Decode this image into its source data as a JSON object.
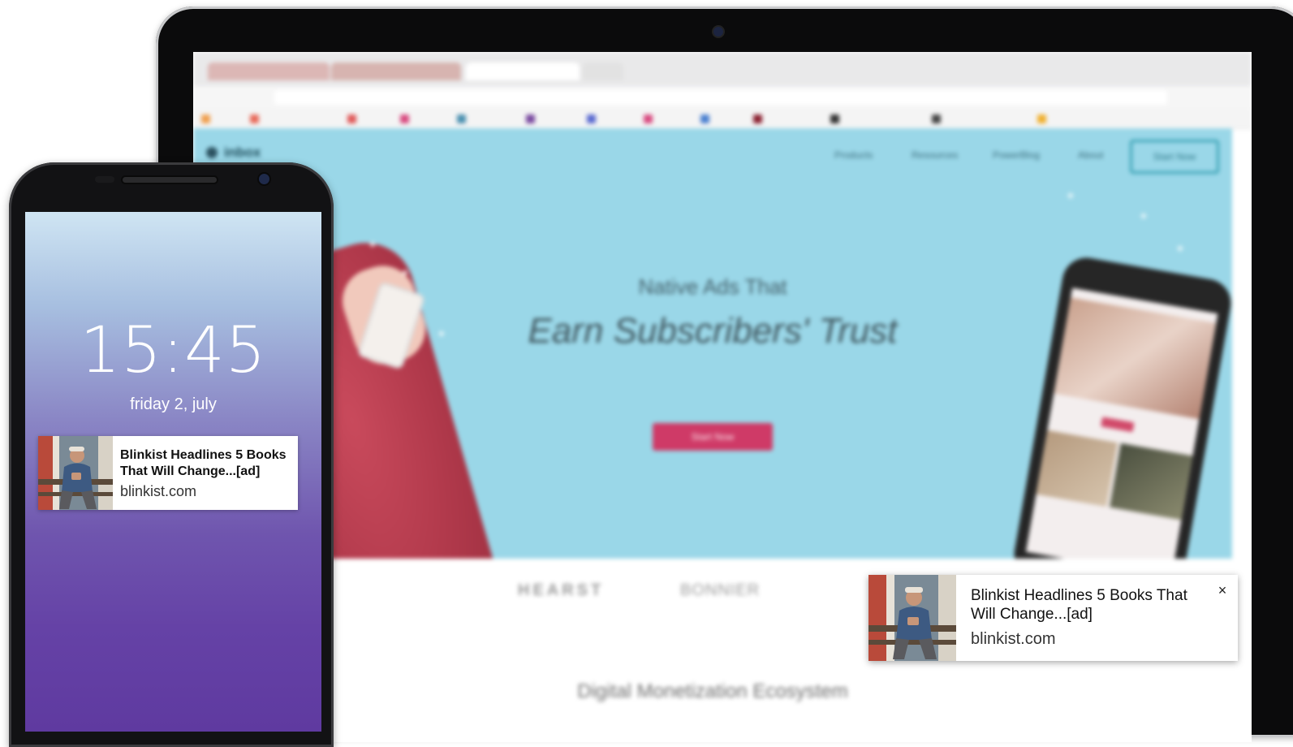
{
  "phone": {
    "lock_time": "15:45",
    "lock_date": "friday 2, july",
    "notification": {
      "title": "Blinkist Headlines 5 Books That Will Change...[ad]",
      "domain": "blinkist.com",
      "thumb_icon": "man-reading-phone-photo"
    }
  },
  "desktop_notification": {
    "title": "Blinkist Headlines 5 Books That Will Change...[ad]",
    "domain": "blinkist.com",
    "close_label": "×",
    "thumb_icon": "man-reading-phone-photo"
  },
  "website": {
    "nav": [
      "Products",
      "Resources",
      "PowerBlog",
      "About"
    ],
    "nav_cta": "Start Now",
    "hero_line1": "Native Ads That",
    "hero_line2": "Earn Subscribers' Trust",
    "hero_button": "Start Now",
    "section_title": "Digital Monetization Ecosystem",
    "brands": [
      "HEARST",
      "BONNIER"
    ]
  },
  "colors": {
    "hero_bg": "#9ad7e8",
    "cta_pink": "#cf3a67",
    "phone_gradient_top": "#cfe5f3",
    "phone_gradient_bottom": "#5f3aa0"
  }
}
